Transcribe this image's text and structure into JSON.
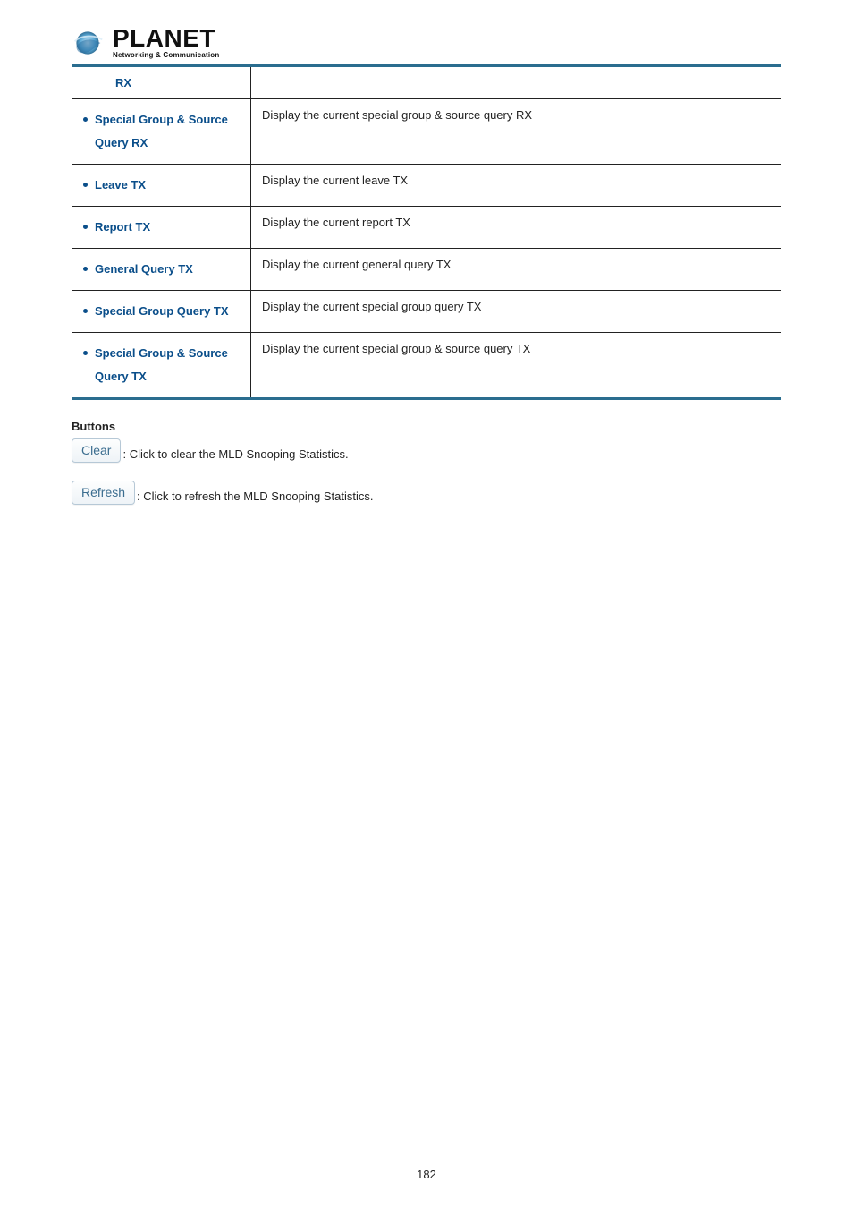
{
  "logo": {
    "brand": "PLANET",
    "tagline": "Networking & Communication"
  },
  "table": {
    "rows": [
      {
        "left": "RX",
        "right": "",
        "continuation": true
      },
      {
        "left": "Special Group & Source Query RX",
        "right": "Display the current special group & source query RX"
      },
      {
        "left": "Leave TX",
        "right": "Display the current leave TX"
      },
      {
        "left": "Report TX",
        "right": "Display the current report TX"
      },
      {
        "left": "General Query TX",
        "right": "Display the current general query TX"
      },
      {
        "left": "Special Group Query TX",
        "right": "Display the current special group query TX"
      },
      {
        "left": "Special Group & Source Query TX",
        "right": "Display the current special group & source query TX"
      }
    ]
  },
  "buttons_section": {
    "title": "Buttons",
    "clear": {
      "label": "Clear",
      "desc": ": Click to clear the MLD Snooping Statistics."
    },
    "refresh": {
      "label": "Refresh",
      "desc": ": Click to refresh the MLD Snooping Statistics."
    }
  },
  "page_number": "182"
}
